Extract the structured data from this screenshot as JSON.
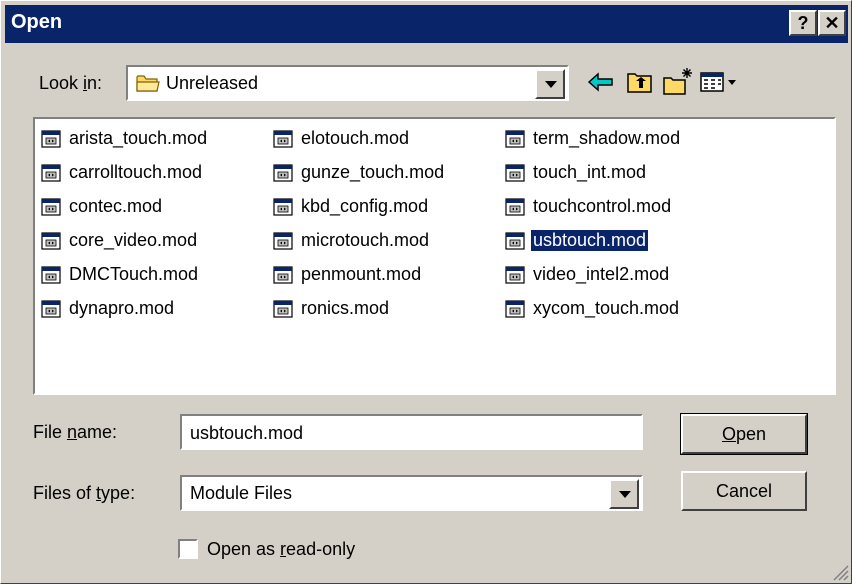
{
  "window": {
    "title": "Open",
    "help_label": "?",
    "close_label": "✕"
  },
  "lookin": {
    "label_pre": "Look ",
    "label_key": "i",
    "label_post": "n:",
    "value": "Unreleased"
  },
  "toolbar": {
    "icons": [
      "back-icon",
      "up-folder-icon",
      "new-folder-icon",
      "view-menu-icon"
    ]
  },
  "files": {
    "columns": [
      [
        "arista_touch.mod",
        "carrolltouch.mod",
        "contec.mod",
        "core_video.mod",
        "DMCTouch.mod",
        "dynapro.mod"
      ],
      [
        "elotouch.mod",
        "gunze_touch.mod",
        "kbd_config.mod",
        "microtouch.mod",
        "penmount.mod",
        "ronics.mod"
      ],
      [
        "term_shadow.mod",
        "touch_int.mod",
        "touchcontrol.mod",
        "usbtouch.mod",
        "video_intel2.mod",
        "xycom_touch.mod"
      ]
    ],
    "selected": "usbtouch.mod"
  },
  "filename": {
    "label_pre": "File ",
    "label_key": "n",
    "label_post": "ame:",
    "value": "usbtouch.mod"
  },
  "filetype": {
    "label_pre": "Files of ",
    "label_key": "t",
    "label_post": "ype:",
    "value": "Module Files"
  },
  "buttons": {
    "open_key": "O",
    "open_rest": "pen",
    "cancel": "Cancel"
  },
  "readonly": {
    "label_pre": "Open as ",
    "label_key": "r",
    "label_post": "ead-only",
    "checked": false
  },
  "colors": {
    "titlebar": "#0a246a",
    "face": "#d4d0c8",
    "selection": "#0a246a",
    "back_arrow": "#00c8c8",
    "folder": "#ffd966"
  }
}
